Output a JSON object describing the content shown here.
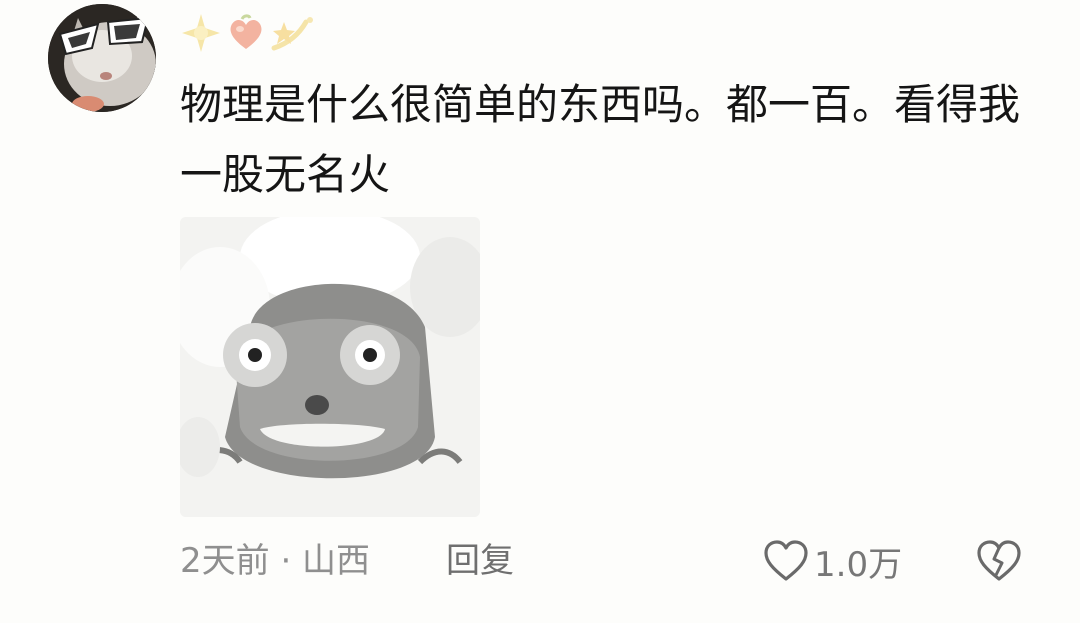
{
  "comment": {
    "user_emojis": [
      "sparkle-star-emoji",
      "peach-heart-emoji",
      "shooting-star-emoji"
    ],
    "text": "物理是什么很简单的东西吗。都一百。看得我一股无名火",
    "time_location": "2天前 · 山西",
    "reply_label": "回复",
    "like_count": "1.0万"
  },
  "icons": {
    "like": "heart-outline-icon",
    "dislike": "broken-heart-icon"
  },
  "colors": {
    "background": "#fdfdfb",
    "text": "#151515",
    "meta_text": "#8f8f8f"
  }
}
